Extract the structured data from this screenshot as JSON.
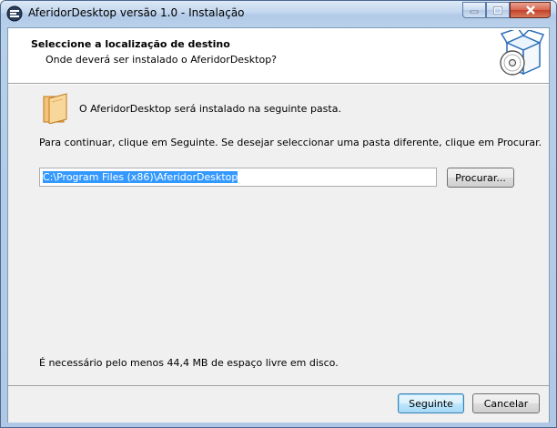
{
  "window": {
    "title": "AferidorDesktop versão 1.0 - Instalação",
    "icon": "installer-app-icon"
  },
  "header": {
    "title": "Seleccione a localização de destino",
    "subtitle": "Onde deverá ser instalado o AferidorDesktop?",
    "icon": "setup-box-disc-icon"
  },
  "body": {
    "info_text": "O AferidorDesktop será instalado na seguinte pasta.",
    "continue_text": "Para continuar, clique em Seguinte. Se desejar seleccionar uma pasta diferente, clique em Procurar.",
    "path_value": "C:\\Program Files (x86)\\AferidorDesktop",
    "browse_label": "Procurar...",
    "space_text": "É necessário pelo menos 44,4 MB de espaço livre em disco."
  },
  "footer": {
    "next_label": "Seguinte",
    "cancel_label": "Cancelar"
  },
  "colors": {
    "selection": "#3399ff",
    "frame": "#b9d0ea",
    "close_button": "#c4402a"
  }
}
